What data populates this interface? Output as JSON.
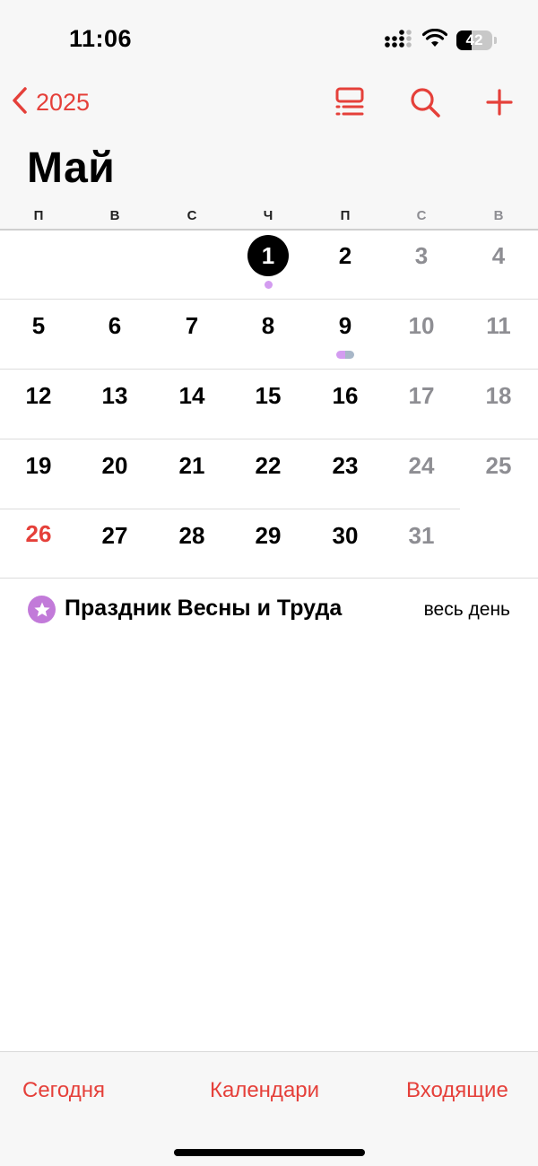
{
  "status_bar": {
    "time": "11:06",
    "battery_level": "42",
    "battery_fraction": 0.42
  },
  "nav": {
    "back_label": "2025"
  },
  "month_title": "Май",
  "weekdays": [
    "П",
    "В",
    "С",
    "Ч",
    "П",
    "С",
    "В"
  ],
  "weeks": [
    [
      "",
      "",
      "",
      "1",
      "2",
      "3",
      "4"
    ],
    [
      "5",
      "6",
      "7",
      "8",
      "9",
      "10",
      "11"
    ],
    [
      "12",
      "13",
      "14",
      "15",
      "16",
      "17",
      "18"
    ],
    [
      "19",
      "20",
      "21",
      "22",
      "23",
      "24",
      "25"
    ],
    [
      "26",
      "27",
      "28",
      "29",
      "30",
      "31",
      ""
    ]
  ],
  "event": {
    "title": "Праздник Весны и Труда",
    "time": "весь день"
  },
  "toolbar": {
    "today": "Сегодня",
    "calendars": "Календари",
    "inbox": "Входящие"
  },
  "colors": {
    "accent": "#e5403a",
    "event": "#c27ad9",
    "weekend": "#8e8e93"
  }
}
